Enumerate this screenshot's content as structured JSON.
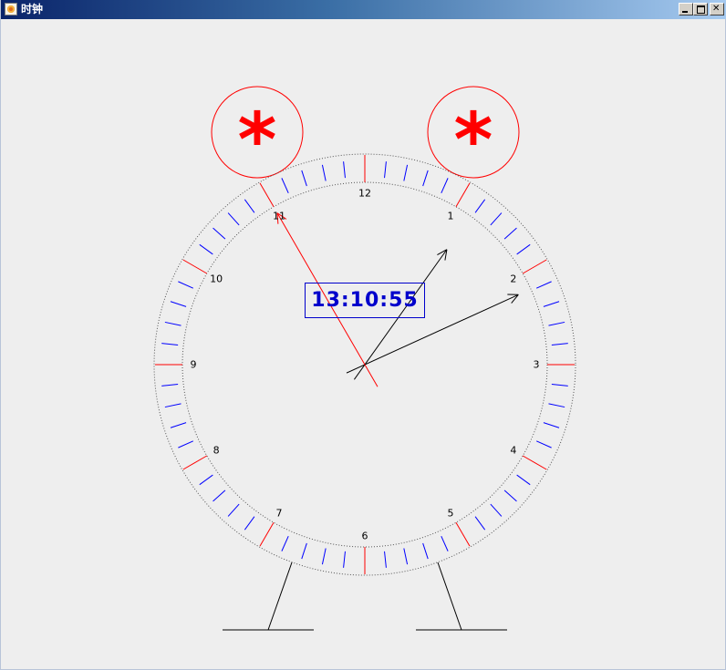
{
  "window": {
    "title": "时钟",
    "controls": {
      "minimize_icon": "minimize-icon",
      "maximize_icon": "maximize-icon",
      "close_icon": "close-icon"
    }
  },
  "clock": {
    "digital_time": "13:10:55",
    "time": {
      "hours": 13,
      "minutes": 10,
      "seconds": 55
    },
    "hour_labels": [
      "12",
      "1",
      "2",
      "3",
      "4",
      "5",
      "6",
      "7",
      "8",
      "9",
      "10",
      "11"
    ],
    "bell_symbol": "*",
    "colors": {
      "bell": "#ff0000",
      "major_tick": "#ff0000",
      "minor_tick": "#0000ff",
      "second_hand": "#ff0000",
      "hour_minute_hand": "#000000",
      "digital_text": "#0000cc",
      "dotted_ring": "#555555"
    }
  }
}
